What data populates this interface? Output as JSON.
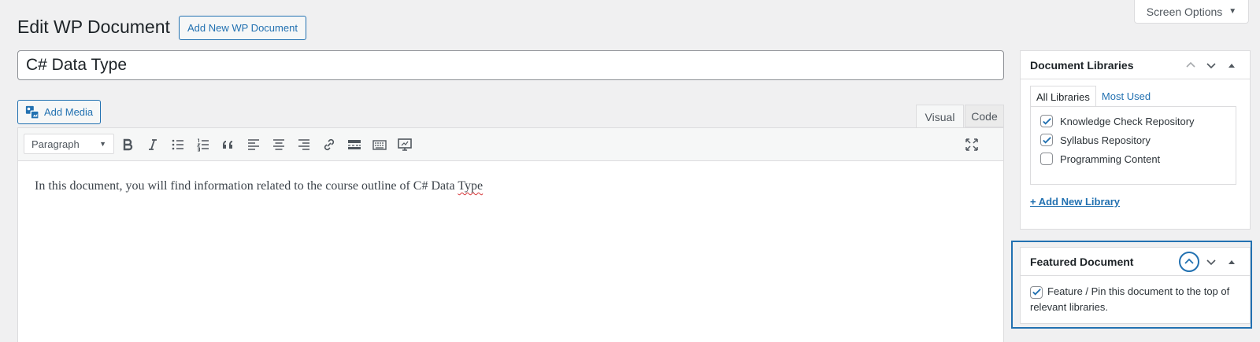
{
  "screen_options": {
    "label": "Screen Options",
    "arrow": "▼"
  },
  "header": {
    "title": "Edit WP Document",
    "add_new_label": "Add New WP Document"
  },
  "post": {
    "title_value": "C# Data Type"
  },
  "editor": {
    "add_media_label": "Add Media",
    "tabs": {
      "visual": "Visual",
      "code": "Code"
    },
    "format_value": "Paragraph",
    "toolbar_icons": [
      "bold-icon",
      "italic-icon",
      "bulleted-list-icon",
      "numbered-list-icon",
      "blockquote-icon",
      "align-left-icon",
      "align-center-icon",
      "align-right-icon",
      "link-icon",
      "read-more-icon",
      "toolbar-toggle-icon",
      "display-icon",
      "fullscreen-icon"
    ],
    "content_before": "In this document, you will find information related to the course outline of C# Data ",
    "content_misspelled": "Type"
  },
  "libraries": {
    "title": "Document Libraries",
    "tab_all": "All Libraries",
    "tab_used": "Most Used",
    "items": [
      {
        "label": "Knowledge Check Repository",
        "checked": true
      },
      {
        "label": "Syllabus Repository",
        "checked": true
      },
      {
        "label": "Programming Content",
        "checked": false
      }
    ],
    "add_label": "+ Add New Library"
  },
  "featured": {
    "title": "Featured Document",
    "checkbox_label": "Feature / Pin this document to the top of relevant libraries.",
    "checked": true
  },
  "colors": {
    "accent": "#2271b1",
    "bg": "#f0f0f1",
    "spell_error": "#d63638"
  }
}
